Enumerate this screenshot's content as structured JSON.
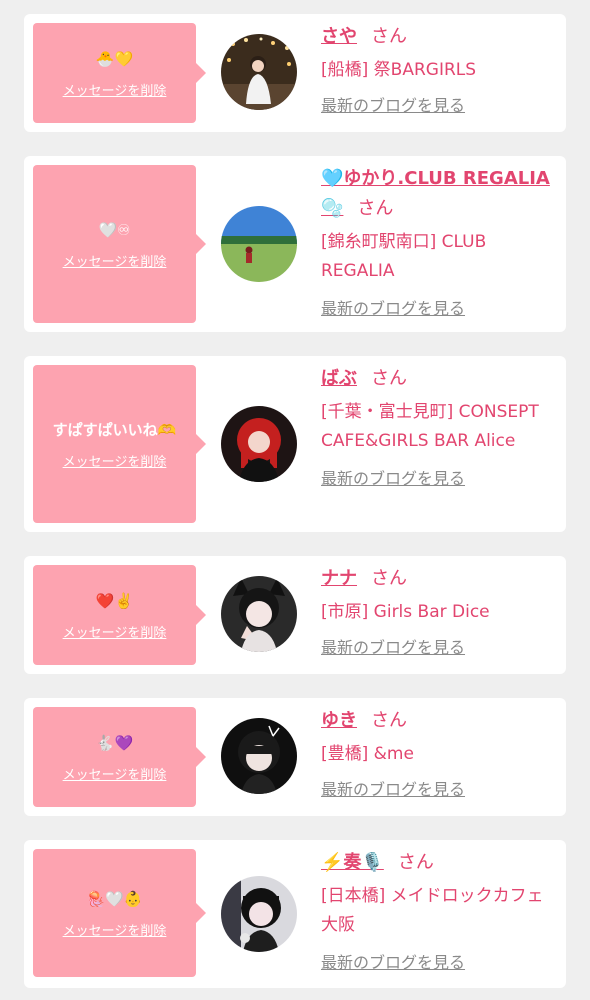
{
  "messages": [
    {
      "message": "🐣💛",
      "delete_label": "メッセージを削除",
      "name": "さや",
      "suffix": "さん",
      "shop": "[船橋] 祭BARGIRLS",
      "blog_label": "最新のブログを見る"
    },
    {
      "message": "🤍♾",
      "delete_label": "メッセージを削除",
      "name": "🩵ゆかり.CLUB REGALIA🫧",
      "suffix": "さん",
      "shop": "[錦糸町駅南口] CLUB REGALIA",
      "blog_label": "最新のブログを見る"
    },
    {
      "message": "すぱすぱいいね🫶",
      "delete_label": "メッセージを削除",
      "name": "ばぶ",
      "suffix": "さん",
      "shop": "[千葉・富士見町] CONSEPT CAFE&GIRLS BAR Alice",
      "blog_label": "最新のブログを見る"
    },
    {
      "message": "❤️✌️",
      "delete_label": "メッセージを削除",
      "name": "ナナ",
      "suffix": "さん",
      "shop": "[市原] Girls Bar Dice",
      "blog_label": "最新のブログを見る"
    },
    {
      "message": "🐇💜",
      "delete_label": "メッセージを削除",
      "name": "ゆき",
      "suffix": "さん",
      "shop": "[豊橋] &me",
      "blog_label": "最新のブログを見る"
    },
    {
      "message": "🪼🤍👶",
      "delete_label": "メッセージを削除",
      "name": "⚡️奏🎙️",
      "suffix": "さん",
      "shop": "[日本橋] メイドロックカフェ 大阪",
      "blog_label": "最新のブログを見る"
    }
  ],
  "colors": {
    "accent": "#e2456f",
    "bubble": "#fda3b0",
    "card": "#ffffff",
    "background": "#efefef",
    "link_gray": "#8a8a8a"
  }
}
